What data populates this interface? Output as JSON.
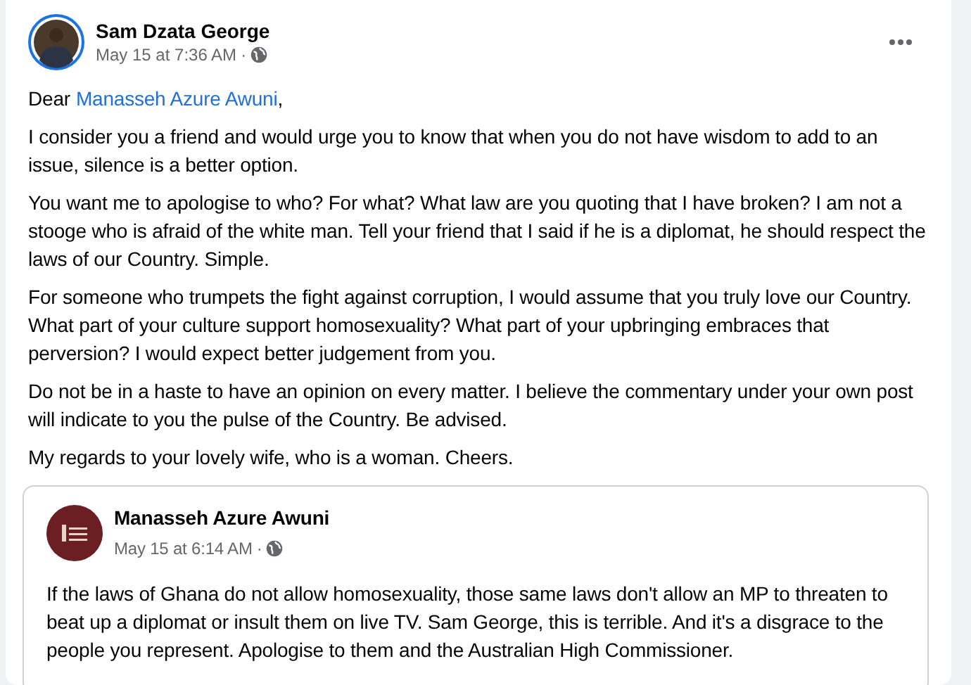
{
  "post": {
    "author": "Sam Dzata George",
    "time": "May 15 at 7:36 AM",
    "separator": "·",
    "greeting": {
      "prefix": "Dear",
      "link": "Manasseh Azure Awuni",
      "suffix": ","
    },
    "paragraphs": [
      "I consider you a friend and would urge you to know that when you do not have wisdom to add to an issue, silence is a better option.",
      "You want me to apologise to who? For what? What law are you quoting that I have broken? I am not a stooge who is afraid of the white man. Tell your friend that I said if he is a diplomat, he should respect the laws of our Country. Simple.",
      "For someone who trumpets the fight against corruption, I would assume that you truly love our Country. What part of your culture support homosexuality? What part of your upbringing embraces that perversion? I would expect better judgement from you.",
      "Do not be in a haste to have an opinion on every matter. I believe the commentary under your own post will indicate to you the pulse of the Country. Be advised.",
      "My regards to your lovely wife, who is a woman. Cheers."
    ]
  },
  "shared_post": {
    "author": "Manasseh Azure Awuni",
    "time": "May 15 at 6:14 AM",
    "separator": "·",
    "text": "If the laws of Ghana do not allow homosexuality, those same laws don't allow an MP to threaten to beat up a diplomat or insult them on live TV. Sam George, this is terrible. And it's a disgrace to the people you represent. Apologise to them and the Australian High Commissioner."
  }
}
